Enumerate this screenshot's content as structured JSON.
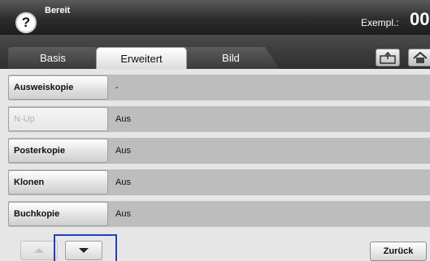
{
  "status": {
    "text": "Bereit",
    "help_icon": "question-mark-icon",
    "copies_label": "Exempl.:",
    "copies_value": "00"
  },
  "tabs": [
    {
      "label": "Basis",
      "active": false
    },
    {
      "label": "Erweitert",
      "active": true
    },
    {
      "label": "Bild",
      "active": false
    }
  ],
  "toolbar": {
    "icons": [
      "tray-icon",
      "home-icon"
    ]
  },
  "rows": [
    {
      "label": "Ausweiskopie",
      "value": "-",
      "enabled": true
    },
    {
      "label": "N-Up",
      "value": "Aus",
      "enabled": false
    },
    {
      "label": "Posterkopie",
      "value": "Aus",
      "enabled": true
    },
    {
      "label": "Klonen",
      "value": "Aus",
      "enabled": true
    },
    {
      "label": "Buchkopie",
      "value": "Aus",
      "enabled": true
    }
  ],
  "navigation": {
    "up_icon": "arrow-up-icon",
    "down_icon": "arrow-down-icon",
    "back_label": "Zurück"
  },
  "colors": {
    "focus": "#1f3fbf",
    "header_dark": "#2c2c2c",
    "row_background": "#bdbdbd"
  }
}
